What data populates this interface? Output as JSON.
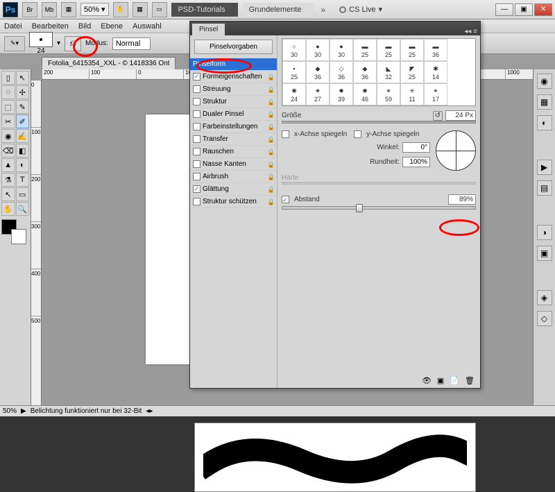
{
  "app": {
    "logo": "Ps",
    "zoom": "50%",
    "cslive": "CS Live"
  },
  "tabs": {
    "dark": "PSD-Tutorials",
    "light": "Grundelemente"
  },
  "winbtn": {
    "min": "—",
    "max": "▣",
    "close": "✕"
  },
  "menu": [
    "Datei",
    "Bearbeiten",
    "Bild",
    "Ebene",
    "Auswahl"
  ],
  "options": {
    "brush_size": "24",
    "mode_label": "Modus:",
    "mode_value": "Normal"
  },
  "doc": {
    "title": "Fotolia_6415354_XXL - © 1418336 Ont"
  },
  "ruler_h": [
    "200",
    "100",
    "0",
    "100"
  ],
  "ruler_v": [
    "0",
    "100",
    "200",
    "300",
    "400",
    "500"
  ],
  "panel": {
    "tab": "Pinsel",
    "presets_btn": "Pinselvorgaben",
    "attrs": [
      "Pinselform",
      "Formeigenschaften",
      "Streuung",
      "Struktur",
      "Dualer Pinsel",
      "Farbeinstellungen",
      "Transfer",
      "Rauschen",
      "Nasse Kanten",
      "Airbrush",
      "Glättung",
      "Struktur schützen"
    ],
    "swatches": [
      30,
      30,
      30,
      25,
      25,
      25,
      36,
      25,
      36,
      36,
      36,
      32,
      25,
      14,
      24,
      27,
      39,
      46,
      59,
      11,
      17
    ],
    "size_label": "Größe",
    "size_value": "24 Px",
    "flip_x": "x-Achse spiegeln",
    "flip_y": "y-Achse spiegeln",
    "winkel_label": "Winkel:",
    "winkel_value": "0°",
    "rundheit_label": "Rundheit:",
    "rundheit_value": "100%",
    "haerte": "Härte",
    "abstand_label": "Abstand",
    "abstand_value": "89%"
  },
  "status": {
    "zoom": "50%",
    "msg": "Belichtung funktioniert nur bei 32-Bit"
  },
  "tools": [
    "▯",
    "↖",
    "◌",
    "✢",
    "⬚",
    "✎",
    "✂",
    "✐",
    "◉",
    "✍",
    "⌫",
    "◧",
    "▲",
    "◐",
    "⚗",
    "░",
    "✎",
    "T",
    "↖",
    "▭",
    "✋",
    "🔍"
  ],
  "ruler_far": "1000"
}
